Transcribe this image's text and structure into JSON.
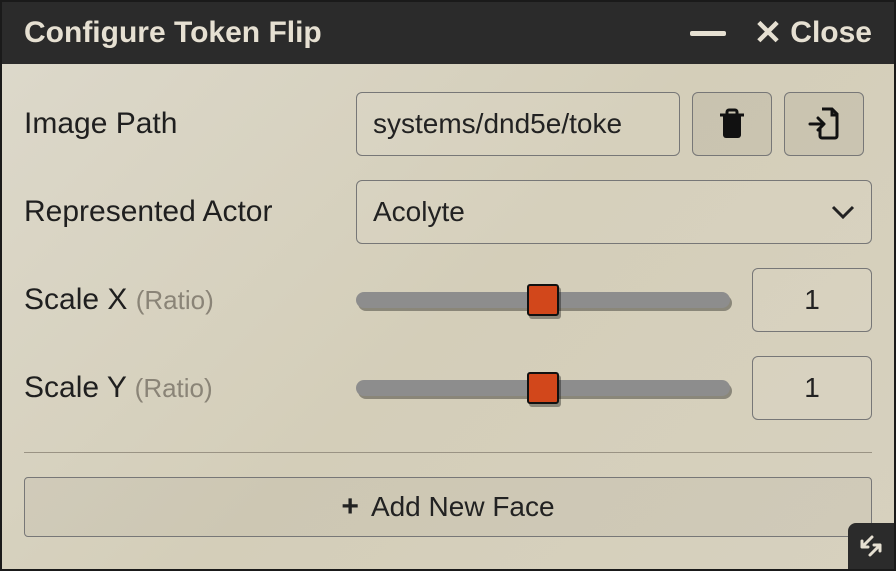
{
  "window": {
    "title": "Configure Token Flip",
    "close_label": "Close"
  },
  "fields": {
    "image_path": {
      "label": "Image Path",
      "value": "systems/dnd5e/toke"
    },
    "actor": {
      "label": "Represented Actor",
      "selected": "Acolyte"
    },
    "scale_x": {
      "label": "Scale X",
      "hint": "(Ratio)",
      "value": "1"
    },
    "scale_y": {
      "label": "Scale Y",
      "hint": "(Ratio)",
      "value": "1"
    }
  },
  "buttons": {
    "add_face": "Add New Face"
  }
}
